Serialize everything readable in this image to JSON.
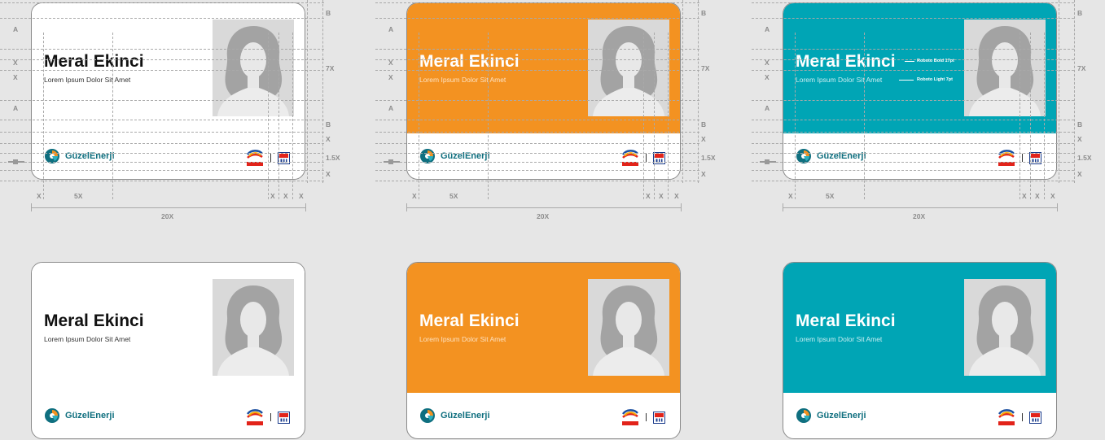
{
  "colors": {
    "background": "#e6e6e6",
    "white_variant": "#ffffff",
    "orange_variant": "#f39221",
    "teal_variant": "#00a5b5",
    "brand_text": "#0f6f7f",
    "guide": "#a9a9a9"
  },
  "card": {
    "name": "Meral Ekinci",
    "subtitle": "Lorem Ipsum Dolor Sit Amet",
    "brand_name": "GüzelEnerji",
    "partner_1_text": "TotalEnergies",
    "partner_2_text": "m oil"
  },
  "variants": [
    {
      "id": "white",
      "band_color": "#ffffff",
      "text_color": "#111111",
      "subtitle_color": "#333333"
    },
    {
      "id": "orange",
      "band_color": "#f39221",
      "text_color": "#ffffff",
      "subtitle_color": "#fde2c2"
    },
    {
      "id": "teal",
      "band_color": "#00a5b5",
      "text_color": "#ffffff",
      "subtitle_color": "#c8eef2"
    }
  ],
  "guides": {
    "left_labels": [
      "A",
      "X",
      "X",
      "A"
    ],
    "right_labels": [
      "B",
      "7X",
      "B",
      "X",
      "1.5X",
      "X"
    ],
    "bottom_labels": [
      "X",
      "5X",
      "X",
      "X",
      "X"
    ],
    "total_width_label": "20X"
  },
  "annotations": {
    "name_font": "Roboto Bold 17pt",
    "subtitle_font": "Roboto Light 7pt"
  }
}
